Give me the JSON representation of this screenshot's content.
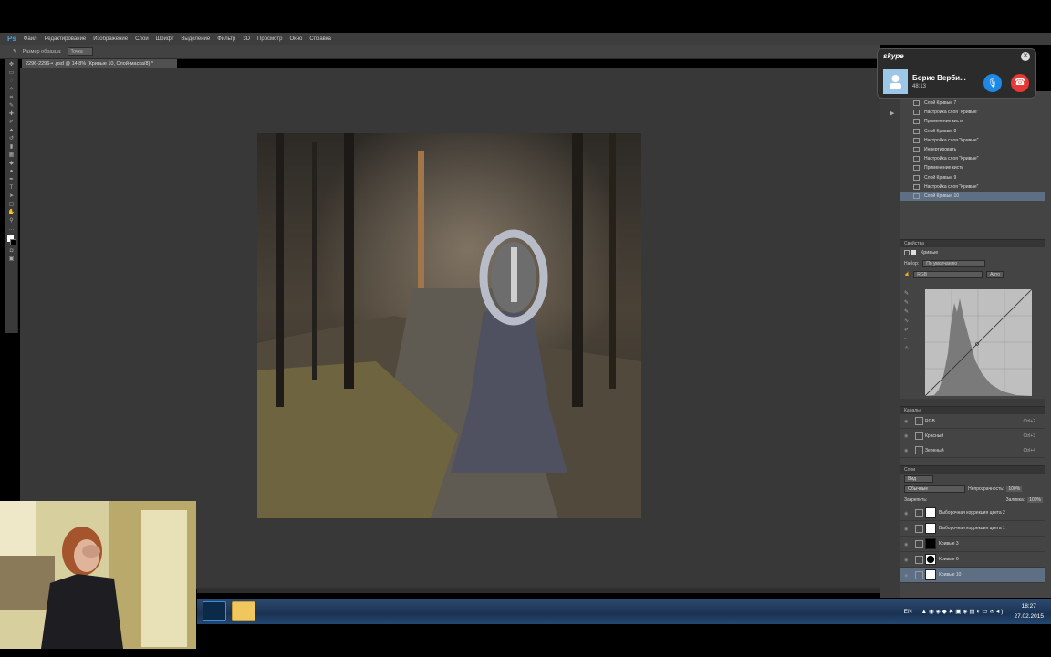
{
  "app": {
    "logo": "Ps",
    "menu": [
      "Файл",
      "Редактирование",
      "Изображение",
      "Слои",
      "Шрифт",
      "Выделение",
      "Фильтр",
      "3D",
      "Просмотр",
      "Окно",
      "Справка"
    ]
  },
  "options": {
    "label": "Размер образца:",
    "value": "Точка"
  },
  "document": {
    "tab": "2296-2296-• .psd @ 14,8% (Кривые 10, Слой-маска/8) *"
  },
  "skype": {
    "brand": "skype",
    "caller": "Борис Верби...",
    "duration": "48:13"
  },
  "history": [
    "Слой Кривые 7",
    "Настройка слоя \"Кривые\"",
    "Применение кисти",
    "Слой Кривые 8",
    "Настройка слоя \"Кривые\"",
    "Инвертировать",
    "Настройка слоя \"Кривые\"",
    "Применение кисти",
    "Слой Кривые 9",
    "Настройка слоя \"Кривые\"",
    "Слой Кривые 10"
  ],
  "properties": {
    "header": "Свойства",
    "title": "Кривые",
    "preset_label": "Набор:",
    "preset_value": "По умолчанию",
    "channel": "RGB",
    "auto": "Авто"
  },
  "channels": {
    "header": "Каналы",
    "rows": [
      {
        "name": "RGB",
        "shortcut": "Ctrl+2"
      },
      {
        "name": "Красный",
        "shortcut": "Ctrl+3"
      },
      {
        "name": "Зеленый",
        "shortcut": "Ctrl+4"
      }
    ]
  },
  "layers": {
    "header": "Слои",
    "kind": "Вид",
    "blend": "Обычные",
    "opacity_label": "Непрозрачность:",
    "opacity": "100%",
    "lock_label": "Закрепить:",
    "fill_label": "Заливка:",
    "fill": "100%",
    "rows": [
      "Выборочная коррекция цвета 2",
      "Выборочная коррекция цвета 1",
      "Кривые 3",
      "Кривые 6",
      "Кривые 10"
    ]
  },
  "tray": {
    "lang": "EN",
    "time": "18:27",
    "date": "27.02.2015"
  }
}
